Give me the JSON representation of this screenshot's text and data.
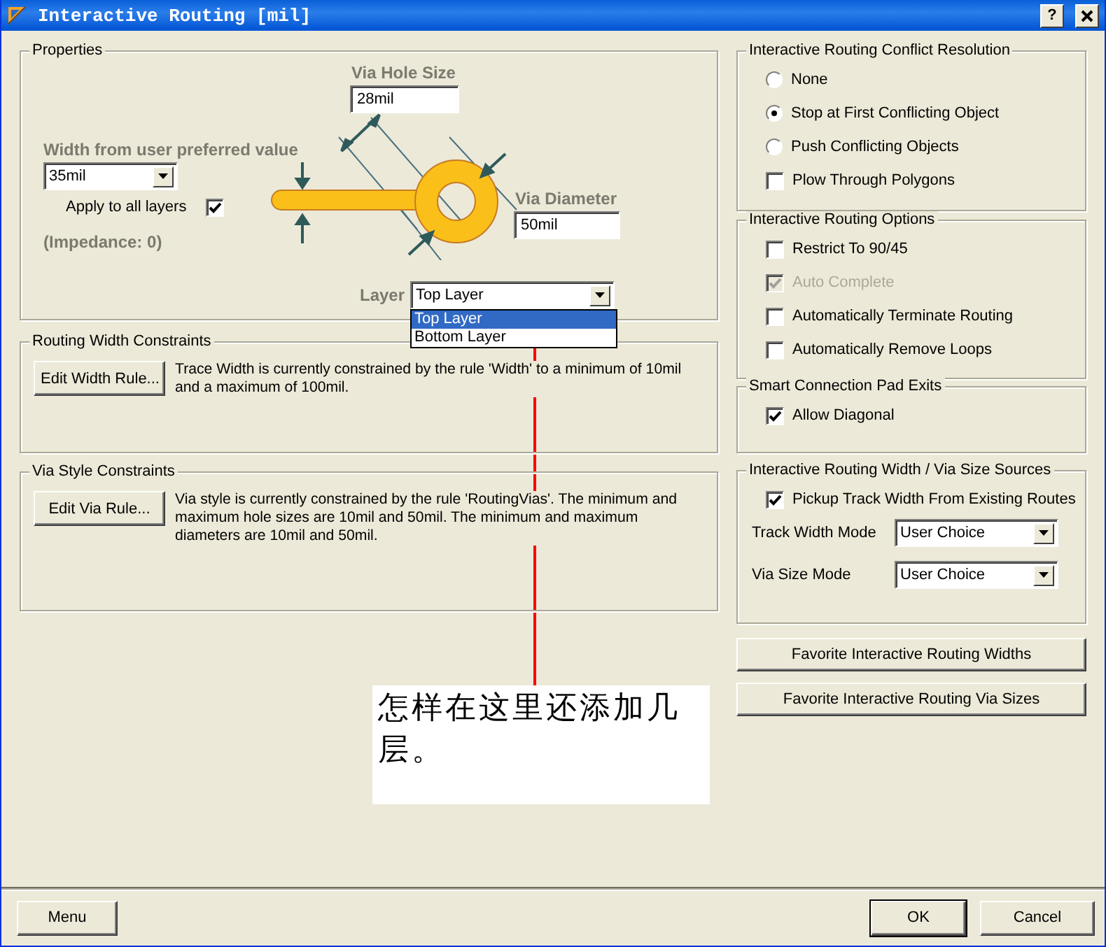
{
  "window": {
    "title": "Interactive Routing [mil]",
    "help_button": "?"
  },
  "properties": {
    "title": "Properties",
    "via_hole_size": {
      "label": "Via Hole Size",
      "value": "28mil"
    },
    "width": {
      "label": "Width from user preferred value",
      "value": "35mil"
    },
    "apply_to_all_layers": {
      "label": "Apply to all layers",
      "checked": true
    },
    "impedance": "(Impedance: 0)",
    "via_diameter": {
      "label": "Via Diameter",
      "value": "50mil"
    },
    "layer": {
      "label": "Layer",
      "value": "Top Layer",
      "expanded": true,
      "options": [
        {
          "label": "Top Layer",
          "selected": true
        },
        {
          "label": "Bottom Layer",
          "selected": false
        }
      ]
    }
  },
  "routing_width_constraints": {
    "title": "Routing Width Constraints",
    "button": "Edit Width Rule...",
    "text": "Trace Width is currently constrained by the rule 'Width' to a minimum of 10mil and a maximum of 100mil."
  },
  "via_style_constraints": {
    "title": "Via Style Constraints",
    "button": "Edit Via Rule...",
    "text": "Via style is currently constrained by the rule 'RoutingVias'. The minimum and maximum hole sizes are 10mil and 50mil. The minimum and maximum diameters are 10mil and 50mil."
  },
  "conflict_resolution": {
    "title": "Interactive Routing Conflict Resolution",
    "items": [
      {
        "kind": "radio",
        "label": "None",
        "selected": false
      },
      {
        "kind": "radio",
        "label": "Stop at First Conflicting Object",
        "selected": true
      },
      {
        "kind": "radio",
        "label": "Push Conflicting Objects",
        "selected": false
      },
      {
        "kind": "checkbox",
        "label": "Plow Through Polygons",
        "checked": false,
        "disabled": false
      }
    ]
  },
  "routing_options": {
    "title": "Interactive Routing Options",
    "items": [
      {
        "label": "Restrict To 90/45",
        "checked": false,
        "disabled": false
      },
      {
        "label": "Auto Complete",
        "checked": true,
        "disabled": true
      },
      {
        "label": "Automatically Terminate Routing",
        "checked": false,
        "disabled": false
      },
      {
        "label": "Automatically Remove Loops",
        "checked": false,
        "disabled": false
      }
    ]
  },
  "pad_exits": {
    "title": "Smart Connection Pad Exits",
    "items": [
      {
        "label": "Allow Diagonal",
        "checked": true,
        "disabled": false
      }
    ]
  },
  "width_sources": {
    "title": "Interactive Routing Width / Via Size Sources",
    "pickup": {
      "label": "Pickup Track Width From Existing Routes",
      "checked": true
    },
    "fields": [
      {
        "label": "Track Width Mode",
        "value": "User Choice"
      },
      {
        "label": "Via Size Mode",
        "value": "User Choice"
      }
    ]
  },
  "favorite_buttons": [
    "Favorite Interactive Routing Widths",
    "Favorite Interactive Routing Via Sizes"
  ],
  "footer_buttons": [
    {
      "label": "Menu",
      "default": false
    },
    {
      "label": "OK",
      "default": true
    },
    {
      "label": "Cancel",
      "default": false
    }
  ],
  "annotation": {
    "text": "怎样在这里还添加几层。"
  }
}
